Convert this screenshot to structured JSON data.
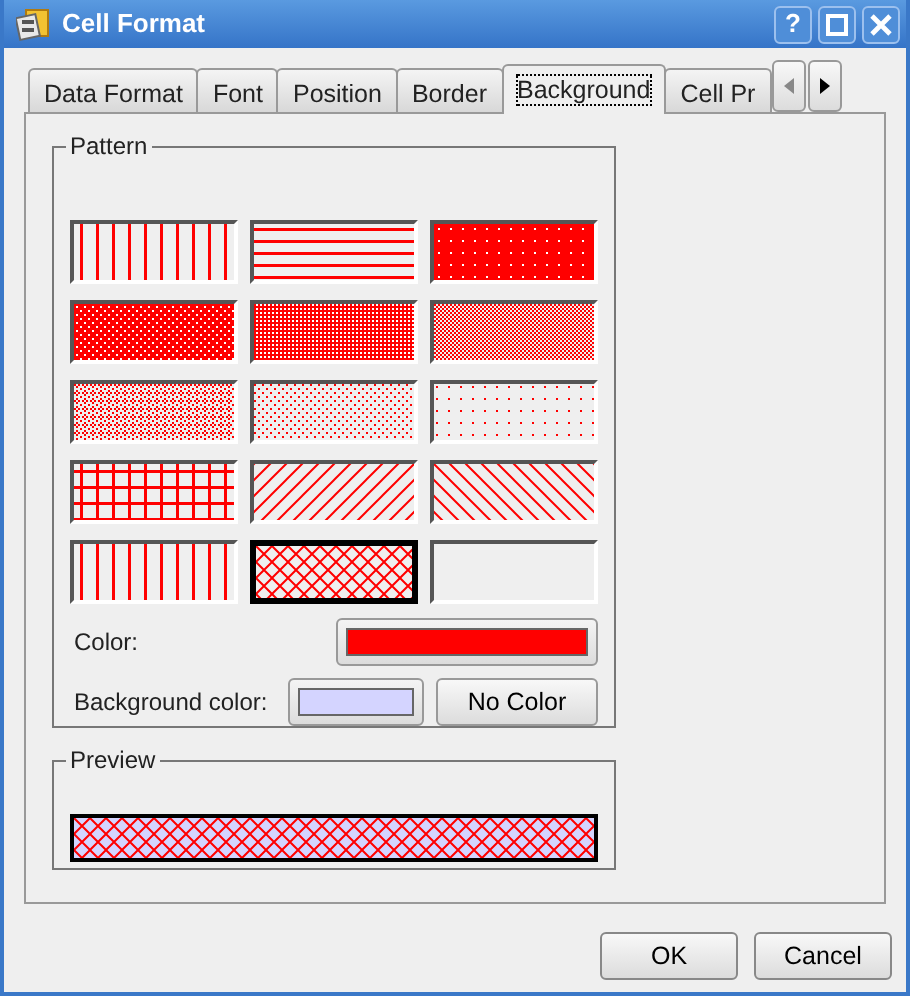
{
  "window": {
    "title": "Cell Format"
  },
  "title_buttons": [
    {
      "kind": "help",
      "label": "?"
    },
    {
      "kind": "maximize"
    },
    {
      "kind": "close"
    }
  ],
  "tabs": [
    {
      "label": "Data Format",
      "selected": false
    },
    {
      "label": "Font",
      "selected": false
    },
    {
      "label": "Position",
      "selected": false
    },
    {
      "label": "Border",
      "selected": false
    },
    {
      "label": "Background",
      "selected": true
    },
    {
      "label": "Cell Pr",
      "selected": false
    }
  ],
  "pattern_group": {
    "title": "Pattern",
    "color": "#ff0000",
    "swatches": [
      {
        "kind": "vertical",
        "selected": false
      },
      {
        "kind": "horizontal",
        "selected": false
      },
      {
        "kind": "dense1",
        "selected": false
      },
      {
        "kind": "dense2",
        "selected": false
      },
      {
        "kind": "dense3",
        "selected": false
      },
      {
        "kind": "dense4",
        "selected": false
      },
      {
        "kind": "dense5",
        "selected": false
      },
      {
        "kind": "dense6",
        "selected": false
      },
      {
        "kind": "dense7",
        "selected": false
      },
      {
        "kind": "cross",
        "selected": false
      },
      {
        "kind": "bdiag",
        "selected": false
      },
      {
        "kind": "fdiag",
        "selected": false
      },
      {
        "kind": "vertical",
        "selected": false
      },
      {
        "kind": "diagcross",
        "selected": true
      },
      {
        "kind": "none",
        "selected": false
      }
    ],
    "color_label": "Color:",
    "background_label": "Background color:",
    "background_swatch": {
      "color": "#d4d4ff"
    },
    "no_color_button": "No Color"
  },
  "preview": {
    "title": "Preview"
  },
  "buttons": [
    "OK",
    "Cancel"
  ]
}
